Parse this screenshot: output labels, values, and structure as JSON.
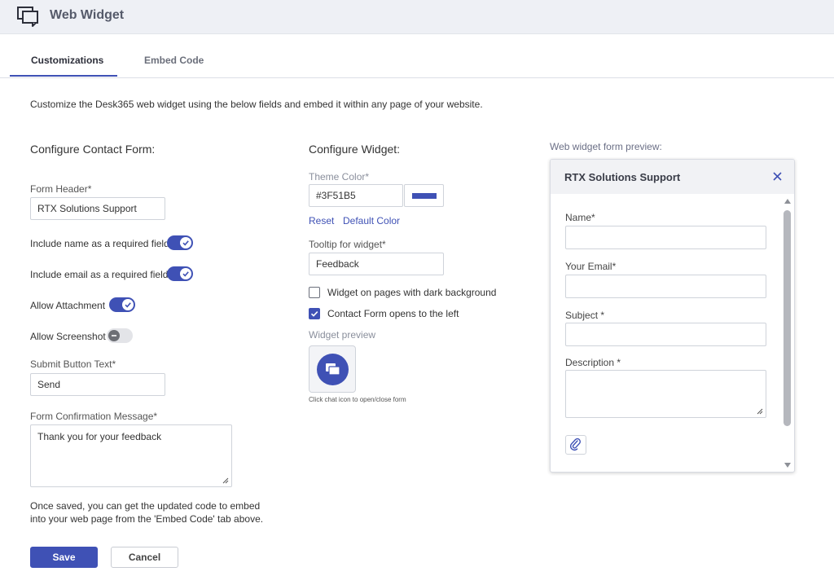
{
  "app": {
    "title": "Web Widget",
    "icon": "chat-windows-icon",
    "accent": "#3F51B5"
  },
  "tabs": [
    {
      "label": "Customizations",
      "active": true
    },
    {
      "label": "Embed Code",
      "active": false
    }
  ],
  "intro": "Customize the Desk365 web widget using the below fields and embed it within any page of your website.",
  "contact_form": {
    "section_title": "Configure Contact Form:",
    "form_header": {
      "label": "Form Header*",
      "value": "RTX Solutions Support"
    },
    "toggles": [
      {
        "label": "Include name as a required field",
        "on": true
      },
      {
        "label": "Include email as a required field",
        "on": true
      },
      {
        "label": "Allow Attachment",
        "on": true
      },
      {
        "label": "Allow Screenshot",
        "on": false
      }
    ],
    "submit_button_text": {
      "label": "Submit Button Text*",
      "value": "Send"
    },
    "confirmation": {
      "label": "Form Confirmation Message*",
      "value": "Thank you for your feedback"
    },
    "note_line1": "Once saved, you can get the updated code to embed",
    "note_line2": "into your web page from the 'Embed Code' tab above.",
    "save_label": "Save",
    "cancel_label": "Cancel"
  },
  "widget": {
    "section_title": "Configure Widget:",
    "theme_color": {
      "label": "Theme Color*",
      "value": "#3F51B5",
      "swatch": "#3F51B5"
    },
    "reset_label": "Reset",
    "default_color_label": "Default Color",
    "tooltip": {
      "label": "Tooltip for widget*",
      "value": "Feedback"
    },
    "checkboxes": [
      {
        "label": "Widget on pages with dark background",
        "checked": false
      },
      {
        "label": "Contact Form opens to the left",
        "checked": true
      }
    ],
    "preview_label": "Widget preview",
    "preview_hint": "Click chat icon to open/close form"
  },
  "form_preview": {
    "caption": "Web widget form preview:",
    "title": "RTX Solutions Support",
    "fields": [
      {
        "label": "Name*"
      },
      {
        "label": "Your Email*"
      },
      {
        "label": "Subject *"
      },
      {
        "label": "Description *"
      }
    ]
  }
}
